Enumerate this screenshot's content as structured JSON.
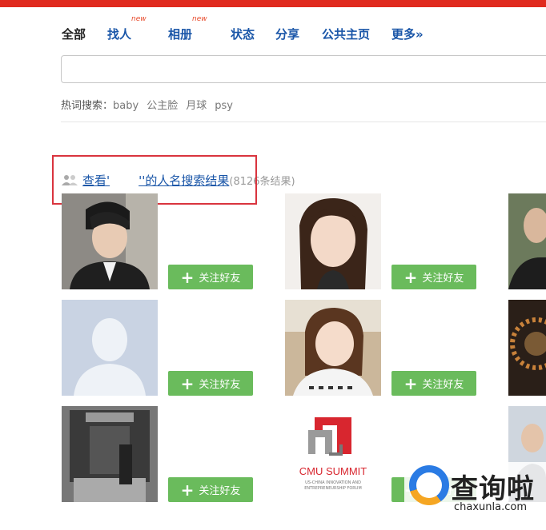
{
  "tabs": [
    {
      "label": "全部",
      "active": true
    },
    {
      "label": "找人",
      "badge": "new"
    },
    {
      "label": "相册",
      "badge": "new"
    },
    {
      "label": "状态"
    },
    {
      "label": "分享"
    },
    {
      "label": "公共主页"
    },
    {
      "label": "更多»"
    }
  ],
  "search": {
    "value": "",
    "placeholder": ""
  },
  "hot_search": {
    "label": "热词搜索：",
    "keywords": [
      "baby",
      "公主脸",
      "月球",
      "psy"
    ]
  },
  "results": {
    "view_link": "查看'",
    "query_link": "''的人名搜索结果",
    "count": "(8126条结果)"
  },
  "follow_label": "关注好友",
  "cmu": {
    "name": "CMU SUMMIT",
    "sub1": "US-CHINA INNOVATION AND",
    "sub2": "ENTREPRENEURSHIP FORUM"
  },
  "watermark": {
    "title": "查询啦",
    "url": "chaxunla.com"
  },
  "colors": {
    "accent": "#e02a1e",
    "link": "#1a56a8",
    "follow_button": "#6abb5c",
    "highlight_box": "#d9343e"
  }
}
